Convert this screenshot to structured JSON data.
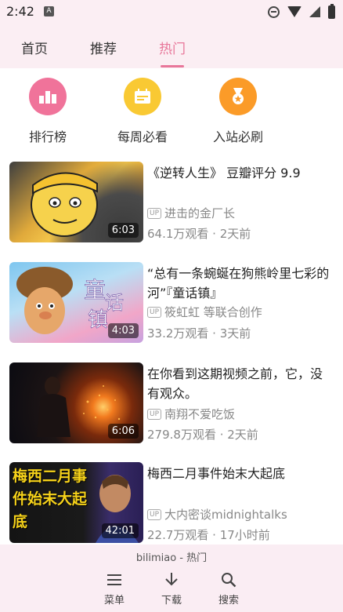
{
  "status_bar": {
    "time": "2:42",
    "notification_badge": "A"
  },
  "tabs": [
    {
      "label": "首页"
    },
    {
      "label": "推荐"
    },
    {
      "label": "热门"
    }
  ],
  "quick_actions": [
    {
      "label": "排行榜",
      "icon": "ranking-icon",
      "color": "#f0739a"
    },
    {
      "label": "每周必看",
      "icon": "calendar-icon",
      "color": "#f9c933"
    },
    {
      "label": "入站必刷",
      "icon": "medal-icon",
      "color": "#fb9b28"
    }
  ],
  "videos": [
    {
      "title": "《逆转人生》 豆瓣评分 9.9",
      "uploader": "进击的金厂长",
      "meta": "64.1万观看 · 2天前",
      "duration": "6:03"
    },
    {
      "title": "“总有一条蜿蜒在狗熊岭里七彩的河”『童话镇』",
      "uploader": "筱虹虹 等联合创作",
      "meta": "33.2万观看 · 3天前",
      "duration": "4:03"
    },
    {
      "title": "在你看到这期视频之前，它，没有观众。",
      "uploader": "南翔不爱吃饭",
      "meta": "279.8万观看 · 2天前",
      "duration": "6:06"
    },
    {
      "title": "梅西二月事件始末大起底",
      "uploader": "大内密谈midnightalks",
      "meta": "22.7万观看 · 17小时前",
      "duration": "42:01",
      "thumb_text": "梅西二月事件始末大起底"
    }
  ],
  "bottom_bar": {
    "title": "bilimiao - 热门",
    "items": [
      {
        "label": "菜单",
        "icon": "menu-icon"
      },
      {
        "label": "下载",
        "icon": "download-icon"
      },
      {
        "label": "搜索",
        "icon": "search-icon"
      }
    ]
  },
  "up_badge": "UP"
}
